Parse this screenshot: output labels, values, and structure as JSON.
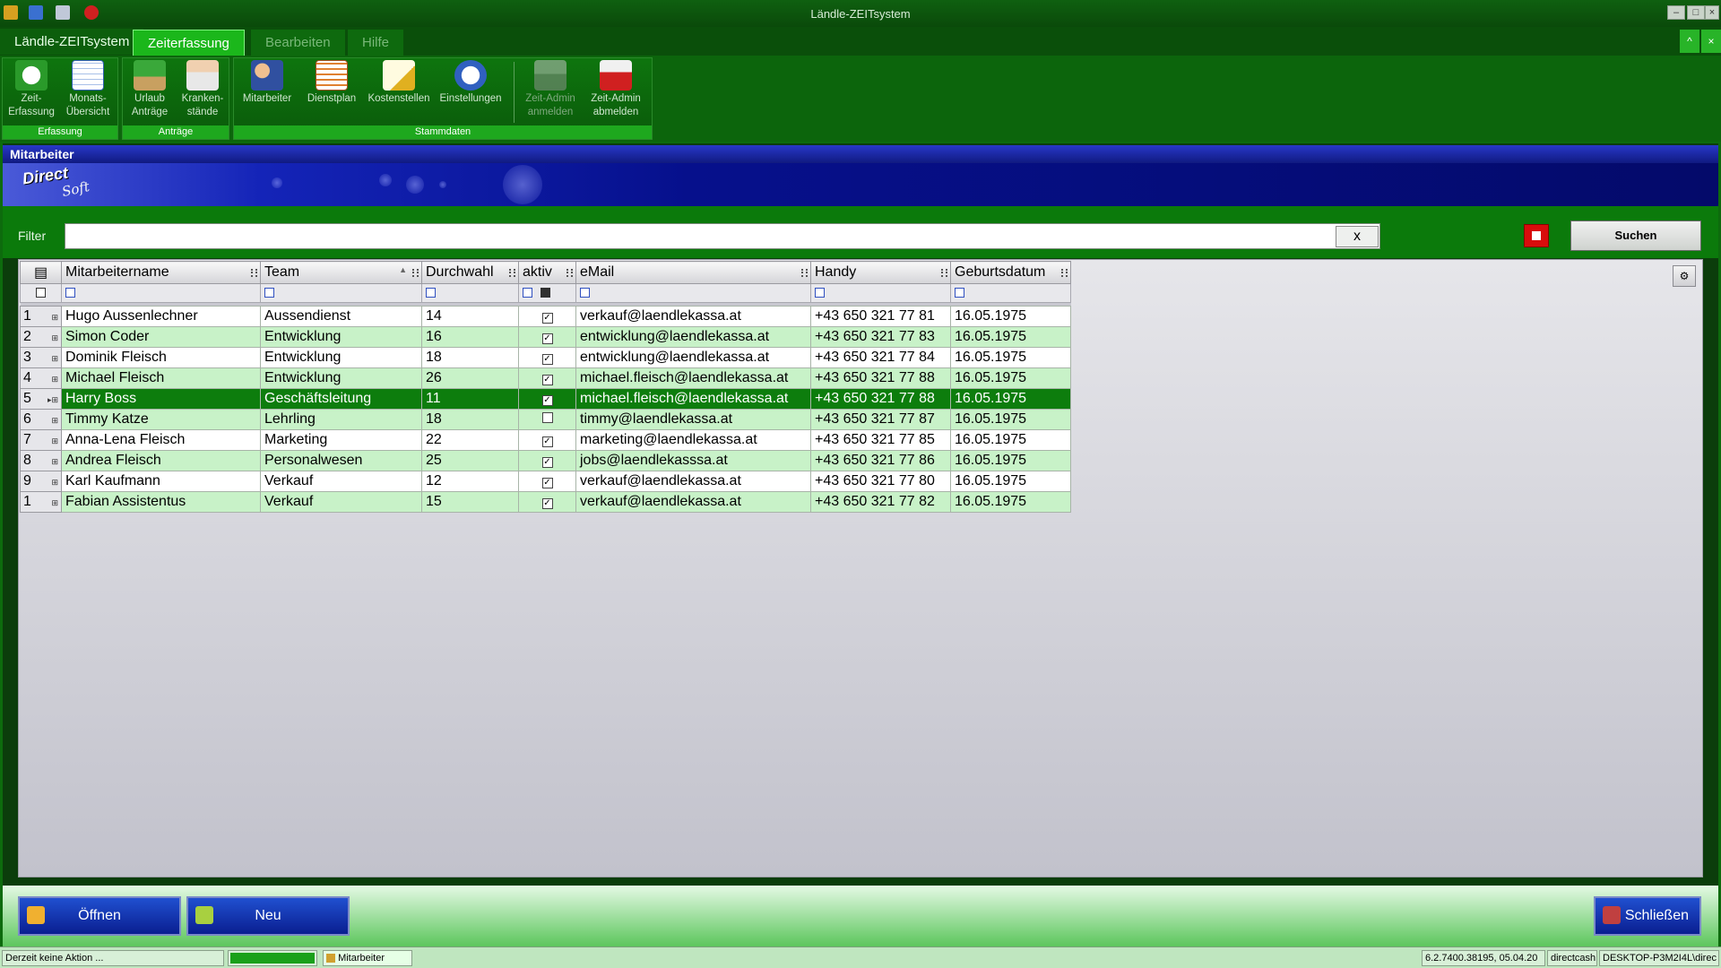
{
  "window": {
    "title": "Ländle-ZEITsystem"
  },
  "tabs": [
    "Ländle-ZEITsystem",
    "Zeiterfassung",
    "Bearbeiten",
    "Hilfe"
  ],
  "ribbon": {
    "groups": [
      "Erfassung",
      "Anträge",
      "Stammdaten"
    ],
    "buttons": {
      "zeit_erfassung": "Zeit-\nErfassung",
      "monats_uebersicht": "Monats-\nÜbersicht",
      "urlaub_antraege": "Urlaub\nAnträge",
      "krankenstaende": "Kranken-\nstände",
      "mitarbeiter": "Mitarbeiter",
      "dienstplan": "Dienstplan",
      "kostenstellen": "Kostenstellen",
      "einstellungen": "Einstellungen",
      "zeitadmin_anmelden": "Zeit-Admin\nanmelden",
      "zeitadmin_abmelden": "Zeit-Admin\nabmelden"
    }
  },
  "window_header": "Mitarbeiter",
  "banner": {
    "logo_top": "Direct",
    "logo_bottom": "Soft"
  },
  "filter": {
    "label": "Filter",
    "value": "",
    "clear_label": "x",
    "search_label": "Suchen"
  },
  "grid": {
    "columns": [
      "Mitarbeitername",
      "Team",
      "Durchwahl",
      "aktiv",
      "eMail",
      "Handy",
      "Geburtsdatum"
    ],
    "rows": [
      {
        "num": "1",
        "name": "Hugo Aussenlechner",
        "team": "Aussendienst",
        "dw": "14",
        "aktiv": true,
        "email": "verkauf@laendlekassa.at",
        "handy": "+43 650 321 77 81",
        "geb": "16.05.1975"
      },
      {
        "num": "2",
        "name": "Simon Coder",
        "team": "Entwicklung",
        "dw": "16",
        "aktiv": true,
        "email": "entwicklung@laendlekassa.at",
        "handy": "+43 650 321 77 83",
        "geb": "16.05.1975"
      },
      {
        "num": "3",
        "name": "Dominik Fleisch",
        "team": "Entwicklung",
        "dw": "18",
        "aktiv": true,
        "email": "entwicklung@laendlekassa.at",
        "handy": "+43 650 321 77 84",
        "geb": "16.05.1975"
      },
      {
        "num": "4",
        "name": "Michael Fleisch",
        "team": "Entwicklung",
        "dw": "26",
        "aktiv": true,
        "email": "michael.fleisch@laendlekassa.at",
        "handy": "+43 650 321 77 88",
        "geb": "16.05.1975"
      },
      {
        "num": "5",
        "name": "Harry Boss",
        "team": "Geschäftsleitung",
        "dw": "11",
        "aktiv": true,
        "email": "michael.fleisch@laendlekassa.at",
        "handy": "+43 650 321 77 88",
        "geb": "16.05.1975",
        "selected": true
      },
      {
        "num": "6",
        "name": "Timmy Katze",
        "team": "Lehrling",
        "dw": "18",
        "aktiv": false,
        "email": "timmy@laendlekassa.at",
        "handy": "+43 650 321 77 87",
        "geb": "16.05.1975"
      },
      {
        "num": "7",
        "name": "Anna-Lena Fleisch",
        "team": "Marketing",
        "dw": "22",
        "aktiv": true,
        "email": "marketing@laendlekassa.at",
        "handy": "+43 650 321 77 85",
        "geb": "16.05.1975"
      },
      {
        "num": "8",
        "name": "Andrea Fleisch",
        "team": "Personalwesen",
        "dw": "25",
        "aktiv": true,
        "email": "jobs@laendlekasssa.at",
        "handy": "+43 650 321 77 86",
        "geb": "16.05.1975"
      },
      {
        "num": "9",
        "name": "Karl Kaufmann",
        "team": "Verkauf",
        "dw": "12",
        "aktiv": true,
        "email": "verkauf@laendlekassa.at",
        "handy": "+43 650 321 77 80",
        "geb": "16.05.1975"
      },
      {
        "num": "1",
        "name": "Fabian Assistentus",
        "team": "Verkauf",
        "dw": "15",
        "aktiv": true,
        "email": "verkauf@laendlekassa.at",
        "handy": "+43 650 321 77 82",
        "geb": "16.05.1975"
      }
    ]
  },
  "footer": {
    "open_label": "Öffnen",
    "new_label": "Neu",
    "close_label": "Schließen"
  },
  "status": {
    "action": "Derzeit keine Aktion ...",
    "progress": 1.0,
    "window": "Mitarbeiter",
    "version": "6.2.7400.38195, 05.04.20",
    "user": "directcash",
    "machine": "DESKTOP-P3M2I4L\\direc"
  },
  "colors": {
    "accent": "#0d7d0d",
    "row_alt": "#c8f2c8",
    "header_blue": "#101a80",
    "stop_red": "#d80c0c"
  }
}
